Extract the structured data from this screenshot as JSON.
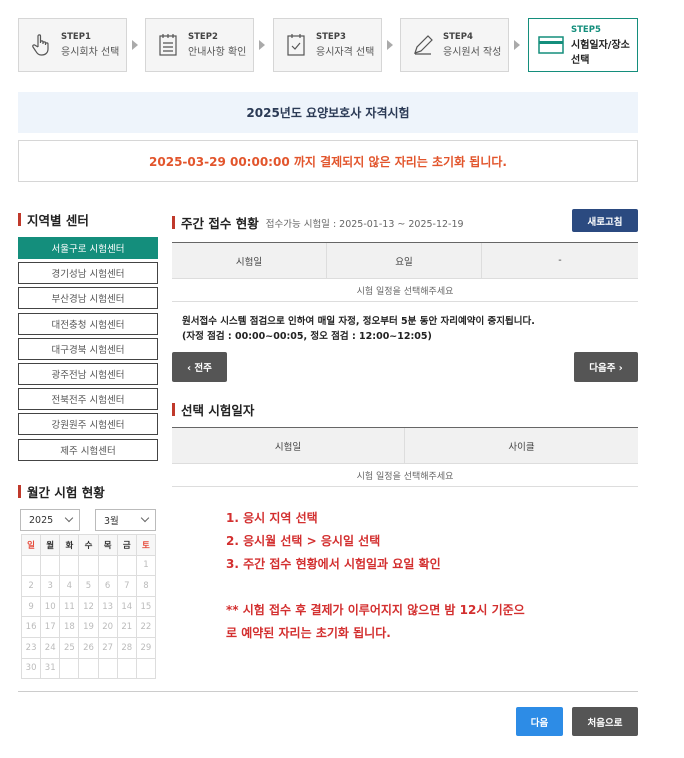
{
  "steps": [
    {
      "no": "STEP1",
      "name": "응시회차 선택",
      "icon": "hand-pointer-icon"
    },
    {
      "no": "STEP2",
      "name": "안내사항 확인",
      "icon": "document-list-icon"
    },
    {
      "no": "STEP3",
      "name": "응시자격 선택",
      "icon": "checklist-icon"
    },
    {
      "no": "STEP4",
      "name": "응시원서 작성",
      "icon": "pencil-icon"
    },
    {
      "no": "STEP5",
      "name1": "시험일자/장소",
      "name2": "선택",
      "icon": "card-icon"
    }
  ],
  "exam_title": "2025년도 요양보호사 자격시험",
  "notice": "2025-03-29 00:00:00 까지 결제되지 않은 자리는 초기화 됩니다.",
  "regional": {
    "title": "지역별 센터",
    "centers": [
      "서울구로 시험센터",
      "경기성남 시험센터",
      "부산경남 시험센터",
      "대전충청 시험센터",
      "대구경북 시험센터",
      "광주전남 시험센터",
      "전북전주 시험센터",
      "강원원주 시험센터",
      "제주 시험센터"
    ]
  },
  "monthly": {
    "title": "월간 시험 현황",
    "year": "2025",
    "month": "3월",
    "weekdays": [
      "일",
      "월",
      "화",
      "수",
      "목",
      "금",
      "토"
    ],
    "weeks": [
      [
        "",
        "",
        "",
        "",
        "",
        "",
        "1"
      ],
      [
        "2",
        "3",
        "4",
        "5",
        "6",
        "7",
        "8"
      ],
      [
        "9",
        "10",
        "11",
        "12",
        "13",
        "14",
        "15"
      ],
      [
        "16",
        "17",
        "18",
        "19",
        "20",
        "21",
        "22"
      ],
      [
        "23",
        "24",
        "25",
        "26",
        "27",
        "28",
        "29"
      ],
      [
        "30",
        "31",
        "",
        "",
        "",
        "",
        ""
      ]
    ]
  },
  "weekly": {
    "title": "주간 접수 현황",
    "period": "접수가능 시험일 : 2025-01-13 ~ 2025-12-19",
    "refresh": "새로고침",
    "headers": [
      "시험일",
      "요일",
      "-"
    ],
    "empty": "시험 일정을 선택해주세요",
    "msg1": "원서접수 시스템 점검으로 인하여 매일 자정, 정오부터 5분 동안 자리예약이 중지됩니다.",
    "msg2": "(자정 점검 : 00:00~00:05, 정오 점검 : 12:00~12:05)",
    "prev": "‹ 전주",
    "next": "다음주 ›"
  },
  "selected": {
    "title": "선택 시험일자",
    "headers": [
      "시험일",
      "사이클"
    ],
    "empty": "시험 일정을 선택해주세요"
  },
  "guide": [
    "1. 응시 지역 선택",
    "2. 응시월 선택 > 응시일 선택",
    "3. 주간 접수 현황에서 시험일과 요일 확인",
    "",
    "** 시험 접수 후 결제가 이루어지지 않으면 밤 12시 기준으",
    "로 예약된 자리는 초기화 됩니다."
  ],
  "footer": {
    "next": "다음",
    "home": "처음으로"
  },
  "colors": {
    "accent": "#148e7c",
    "navy": "#2b4a80",
    "notice": "#e2552c",
    "guide": "#d32f2f"
  }
}
